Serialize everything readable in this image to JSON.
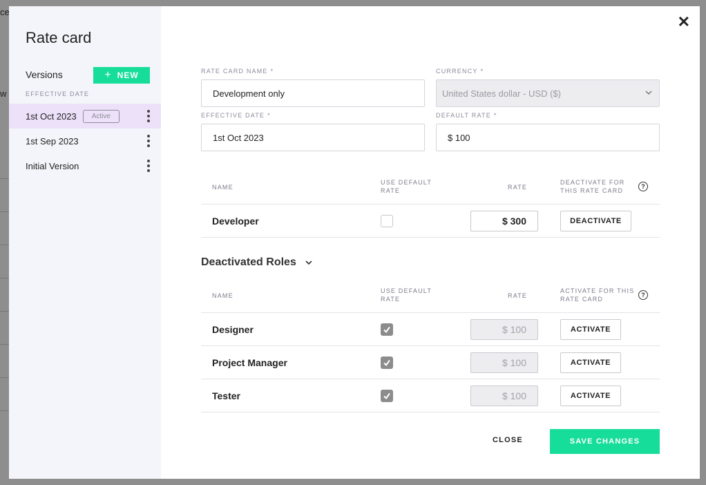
{
  "background": {
    "fragments": [
      "ce",
      "w"
    ]
  },
  "modal": {
    "title": "Rate card",
    "versions_label": "Versions",
    "new_button": "NEW",
    "effective_date_label": "EFFECTIVE DATE",
    "versions": [
      {
        "label": "1st Oct 2023",
        "badge": "Active",
        "selected": true
      },
      {
        "label": "1st Sep 2023",
        "badge": ""
      },
      {
        "label": "Initial Version",
        "badge": ""
      }
    ]
  },
  "form": {
    "rate_card_name_label": "RATE CARD NAME",
    "rate_card_name_value": "Development only",
    "currency_label": "CURRENCY",
    "currency_value": "United States dollar - USD ($)",
    "effective_date_label": "EFFECTIVE DATE",
    "effective_date_value": "1st Oct 2023",
    "default_rate_label": "DEFAULT RATE",
    "default_rate_value": "$ 100",
    "required_mark": "*"
  },
  "active_roles": {
    "headers": {
      "name": "NAME",
      "use_default": "USE DEFAULT RATE",
      "rate": "RATE",
      "action": "DEACTIVATE FOR THIS RATE CARD"
    },
    "rows": [
      {
        "name": "Developer",
        "use_default": false,
        "rate": "$ 300",
        "action": "DEACTIVATE"
      }
    ]
  },
  "deactivated_roles": {
    "title": "Deactivated Roles",
    "headers": {
      "name": "NAME",
      "use_default": "USE DEFAULT RATE",
      "rate": "RATE",
      "action": "ACTIVATE FOR THIS RATE CARD"
    },
    "rows": [
      {
        "name": "Designer",
        "use_default": true,
        "rate": "$ 100",
        "action": "ACTIVATE"
      },
      {
        "name": "Project Manager",
        "use_default": true,
        "rate": "$ 100",
        "action": "ACTIVATE"
      },
      {
        "name": "Tester",
        "use_default": true,
        "rate": "$ 100",
        "action": "ACTIVATE"
      }
    ]
  },
  "footer": {
    "close": "CLOSE",
    "save": "SAVE CHANGES"
  },
  "colors": {
    "accent": "#17dd9a",
    "selected_row": "#ede1f9",
    "sidebar_bg": "#f4f5fa"
  }
}
